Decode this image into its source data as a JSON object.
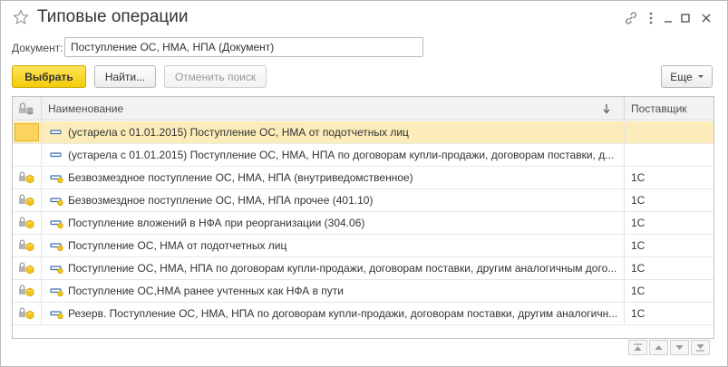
{
  "window": {
    "title": "Типовые операции"
  },
  "document": {
    "label": "Документ:",
    "value": "Поступление ОС, НМА, НПА (Документ)"
  },
  "toolbar": {
    "select_label": "Выбрать",
    "find_label": "Найти...",
    "cancel_search_label": "Отменить поиск",
    "more_label": "Еще"
  },
  "table": {
    "columns": {
      "name": "Наименование",
      "supplier": "Поставщик"
    },
    "rows": [
      {
        "name": "(устарела с 01.01.2015) Поступление ОС, НМА от подотчетных лиц",
        "supplier": "",
        "selected": true,
        "predefined": false
      },
      {
        "name": "(устарела с 01.01.2015) Поступление ОС, НМА, НПА по договорам купли-продажи, договорам поставки, д...",
        "supplier": "",
        "selected": false,
        "predefined": false
      },
      {
        "name": "Безвозмездное поступление ОС, НМА, НПА (внутриведомственное)",
        "supplier": "1С",
        "selected": false,
        "predefined": true
      },
      {
        "name": "Безвозмездное поступление ОС, НМА, НПА прочее (401.10)",
        "supplier": "1С",
        "selected": false,
        "predefined": true
      },
      {
        "name": "Поступление вложений в НФА при реорганизации (304.06)",
        "supplier": "1С",
        "selected": false,
        "predefined": true
      },
      {
        "name": "Поступление ОС, НМА от подотчетных лиц",
        "supplier": "1С",
        "selected": false,
        "predefined": true
      },
      {
        "name": "Поступление ОС, НМА, НПА по договорам купли-продажи, договорам поставки, другим аналогичным дого...",
        "supplier": "1С",
        "selected": false,
        "predefined": true
      },
      {
        "name": "Поступление ОС,НМА ранее учтенных как НФА в пути",
        "supplier": "1С",
        "selected": false,
        "predefined": true
      },
      {
        "name": "Резерв. Поступление ОС, НМА, НПА по договорам купли-продажи, договорам поставки, другим аналогичн...",
        "supplier": "1С",
        "selected": false,
        "predefined": true
      }
    ]
  },
  "icons": {
    "favorite": "star-icon",
    "link": "link-icon",
    "menu": "kebab-icon",
    "minimize": "minimize-icon",
    "maximize": "maximize-icon",
    "close": "close-icon",
    "sort": "sort-down-arrow-icon",
    "header_state": "lock-db-icon",
    "row_state": "lock-cube-icon",
    "item": "document-item-icon"
  },
  "colors": {
    "accent_yellow": "#f4cc08",
    "selected_row": "#fbecb9",
    "selected_cell": "#fcd35e",
    "item_icon_blue": "#3f6fb3",
    "item_icon_yellow": "#f0c419"
  }
}
